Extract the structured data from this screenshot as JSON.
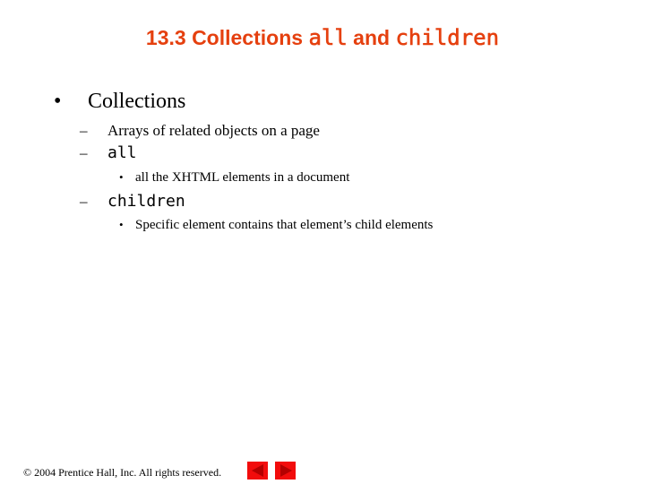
{
  "title": {
    "prefix": "13.3  Collections ",
    "code1": "all",
    "middle": " and ",
    "code2": "children"
  },
  "bullets": {
    "level1": {
      "bullet": "•",
      "text": "Collections"
    },
    "items": [
      {
        "dash": "–",
        "text": "Arrays of related objects on a page"
      },
      {
        "dash": "–",
        "code": "all",
        "sub": {
          "dot": "•",
          "text": "all the XHTML elements in a document"
        }
      },
      {
        "dash": "–",
        "code": "children",
        "sub": {
          "dot": "•",
          "text": "Specific element contains that element’s child elements"
        }
      }
    ]
  },
  "footer": {
    "copyright": "© 2004 Prentice Hall, Inc.  All rights reserved."
  },
  "nav": {
    "prev_icon": "left-triangle-icon",
    "next_icon": "right-triangle-icon",
    "button_color": "#f20c0c",
    "arrow_color": "#b30000"
  },
  "colors": {
    "title": "#e5400f",
    "text": "#000000",
    "background": "#ffffff"
  }
}
